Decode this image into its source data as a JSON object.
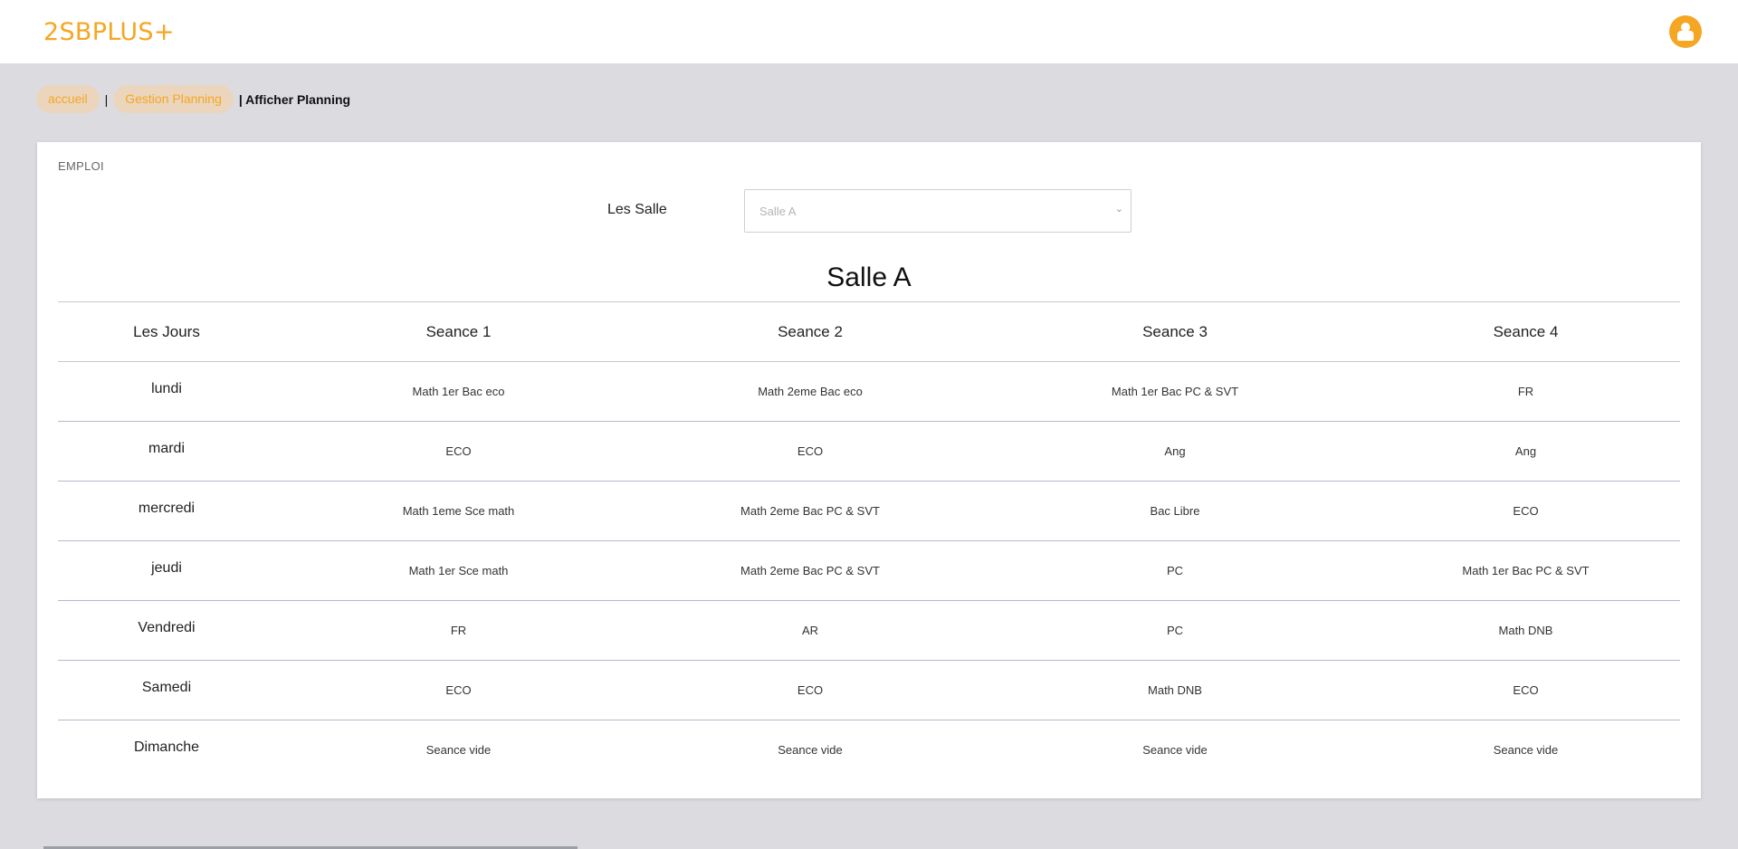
{
  "brand": {
    "title": "2SBPLUS+"
  },
  "header": {
    "avatar_icon": "user-icon"
  },
  "breadcrumb": {
    "home": "accueil",
    "section": "Gestion Planning",
    "separator": "|",
    "current": "| Afficher Planning"
  },
  "card": {
    "title": "EMPLOI",
    "filter_label": "Les Salle",
    "selected_salle": "Salle A",
    "heading": "Salle A"
  },
  "table": {
    "headers": [
      "Les Jours",
      "Seance 1",
      "Seance 2",
      "Seance 3",
      "Seance 4"
    ],
    "rows": [
      {
        "day": "lundi",
        "s1": "Math 1er Bac eco",
        "s2": "Math 2eme Bac eco",
        "s3": "Math 1er Bac PC & SVT",
        "s4": "FR"
      },
      {
        "day": "mardi",
        "s1": "ECO",
        "s2": "ECO",
        "s3": "Ang",
        "s4": "Ang"
      },
      {
        "day": "mercredi",
        "s1": "Math 1eme Sce math",
        "s2": "Math 2eme Bac PC & SVT",
        "s3": "Bac Libre",
        "s4": "ECO"
      },
      {
        "day": "jeudi",
        "s1": "Math 1er Sce math",
        "s2": "Math 2eme Bac PC & SVT",
        "s3": "PC",
        "s4": "Math 1er Bac PC & SVT"
      },
      {
        "day": "Vendredi",
        "s1": "FR",
        "s2": "AR",
        "s3": "PC",
        "s4": "Math DNB"
      },
      {
        "day": "Samedi",
        "s1": "ECO",
        "s2": "ECO",
        "s3": "Math DNB",
        "s4": "ECO"
      },
      {
        "day": "Dimanche",
        "s1": "Seance vide",
        "s2": "Seance vide",
        "s3": "Seance vide",
        "s4": "Seance vide"
      }
    ]
  },
  "colors": {
    "accent": "#f5a623",
    "crumb_bg": "#ebd6bd",
    "page_bg": "#dcdbe0"
  }
}
